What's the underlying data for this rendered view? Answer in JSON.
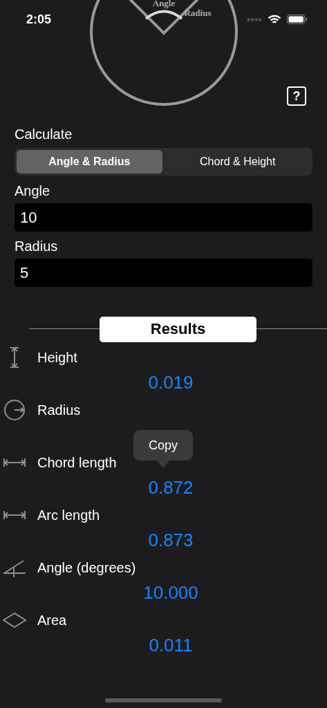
{
  "status_bar": {
    "time": "2:05"
  },
  "diagram": {
    "angle_label": "Angle",
    "radius_label": "Radius"
  },
  "help_button": {
    "label": "?"
  },
  "calculate": {
    "title": "Calculate",
    "tabs": [
      {
        "label": "Angle & Radius",
        "selected": true
      },
      {
        "label": "Chord & Height",
        "selected": false
      }
    ]
  },
  "fields": [
    {
      "label": "Angle",
      "value": "10"
    },
    {
      "label": "Radius",
      "value": "5"
    }
  ],
  "results": {
    "title": "Results",
    "rows": [
      {
        "kind": "height",
        "label": "Height",
        "value": "0.019"
      },
      {
        "kind": "radius",
        "label": "Radius"
      },
      {
        "kind": "chord",
        "label": "Chord length",
        "value": "0.872"
      },
      {
        "kind": "arc",
        "label": "Arc length",
        "value": "0.873"
      },
      {
        "kind": "angle",
        "label": "Angle (degrees)",
        "value": "10.000"
      },
      {
        "kind": "area",
        "label": "Area",
        "value": "0.011"
      }
    ]
  },
  "tooltip": {
    "label": "Copy"
  }
}
